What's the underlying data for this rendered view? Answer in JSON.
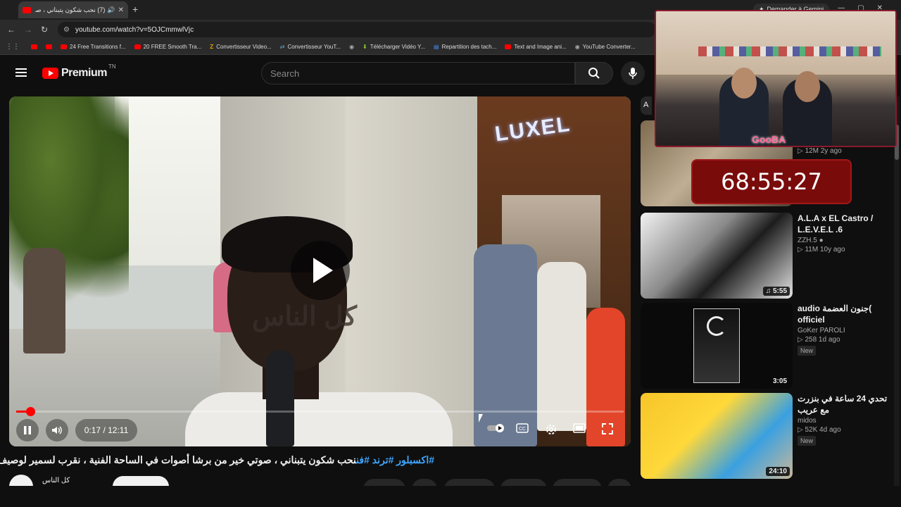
{
  "browser": {
    "tab_title": "(7) نحب شكون يتبناني ، صوتي...",
    "url": "youtube.com/watch?v=5OJCmmwlVjc",
    "gemini_label": "Demander à Gemini",
    "bookmarks": [
      "24 Free Transitions f...",
      "20 FREE Smooth Tra...",
      "Convertisseur Video...",
      "Convertisseur YouT...",
      "Télécharger Vidéo Y...",
      "Repartition des tach...",
      "Text and Image ani...",
      "YouTube Converter..."
    ]
  },
  "youtube": {
    "logo_text": "Premium",
    "country": "TN",
    "search_placeholder": "Search"
  },
  "player": {
    "watermark": "كل الناس",
    "time": "0:17 / 12:11",
    "progress": 0.023
  },
  "video": {
    "tags": "#اكسبلور #ترند #فن",
    "title": "نحب شكون يتبناني ، صوتي خير من برشا أصوات في الساحة الفنية ، نقرب لسمير لوصيف",
    "channel": "كل الناس"
  },
  "sidebar": {
    "items": [
      {
        "title": "",
        "channel": "",
        "stats": "12M  2y ago",
        "duration": "",
        "badge": ""
      },
      {
        "title": "A.L.A x EL Castro / L.E.V.E.L .6",
        "channel": "ZZH.5",
        "stats": "11M  10y ago",
        "duration": "5:55",
        "badge": ""
      },
      {
        "title": "audio جنون العضمة( officiel",
        "channel": "GoKer PAROLI",
        "stats": "258  1d ago",
        "duration": "3:05",
        "badge": "New"
      },
      {
        "title": "تحدي 24 ساعة في بنزرت مع عريب",
        "channel": "midos",
        "stats": "52K  4d ago",
        "duration": "24:10",
        "badge": "New"
      }
    ]
  },
  "overlay": {
    "brand": "GooBA",
    "timer": "68:55:27"
  },
  "colors": {
    "accent": "#ff0000",
    "link": "#3ea6ff",
    "background": "#0f0f0f"
  }
}
